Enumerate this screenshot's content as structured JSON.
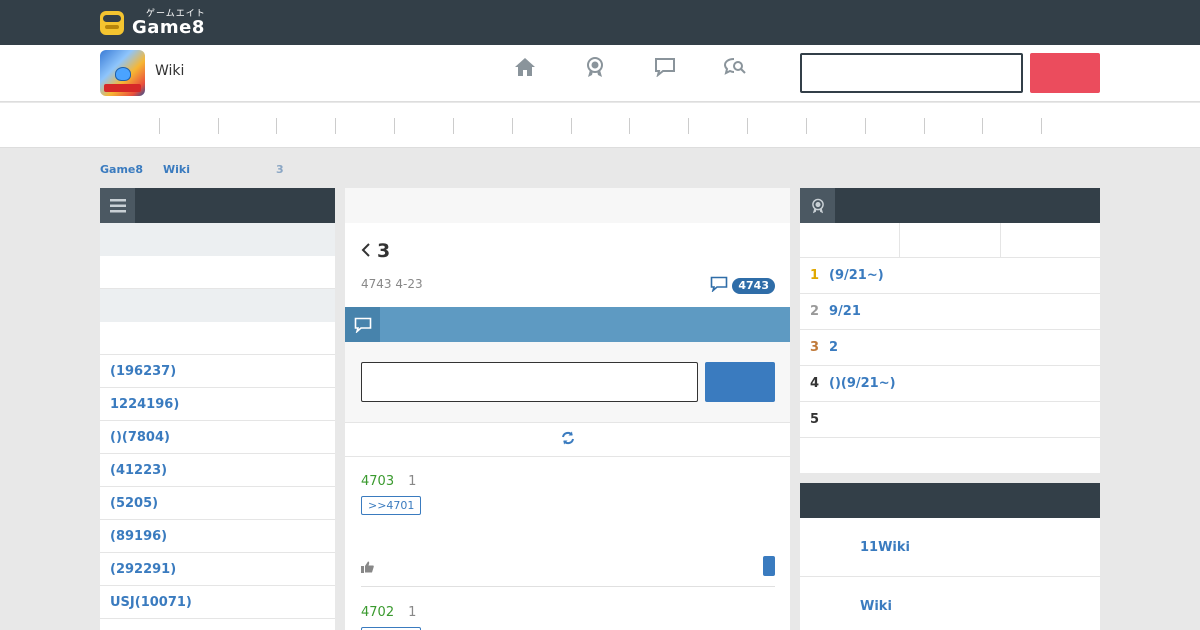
{
  "topbar": {
    "logo_kana": "ゲームエイト",
    "logo_word": "Game8"
  },
  "header": {
    "wiki_label": "Wiki",
    "search": {
      "value": "",
      "placeholder": ""
    },
    "search_button_label": ""
  },
  "breadcrumb": {
    "home": "Game8",
    "wiki": "Wiki",
    "current": "3"
  },
  "left": {
    "items": [
      {
        "label": "(196237)"
      },
      {
        "label": "1224196)"
      },
      {
        "label": "()(7804)"
      },
      {
        "label": "(41223)"
      },
      {
        "label": "(5205)"
      },
      {
        "label": "(89196)"
      },
      {
        "label": "(292291)"
      },
      {
        "label": "USJ(10071)"
      }
    ]
  },
  "thread": {
    "title": "3",
    "meta": "4743 4-23",
    "comment_count": "4743",
    "comment_input": {
      "value": "",
      "placeholder": ""
    },
    "post_button_label": "",
    "posts": [
      {
        "number": "4703",
        "sub": "1",
        "reply": ">>4701"
      },
      {
        "number": "4702",
        "sub": "1",
        "reply": ""
      }
    ]
  },
  "ranking": {
    "rows": [
      {
        "rank": "1",
        "text": "(9/21~)",
        "color": "#e0a800"
      },
      {
        "rank": "2",
        "text": "9/21",
        "color": "#999999"
      },
      {
        "rank": "3",
        "text": "2",
        "color": "#c07a3a"
      },
      {
        "rank": "4",
        "text": "()(9/21~)",
        "color": "#333333"
      },
      {
        "rank": "5",
        "text": "",
        "color": "#333333"
      }
    ]
  },
  "related": {
    "items": [
      {
        "label": "11Wiki"
      },
      {
        "label": "Wiki"
      }
    ]
  },
  "colors": {
    "topbar": "#333f48",
    "accent_blue": "#3a7bbf",
    "search_red": "#eb4c5d",
    "section_blue": "#5e9ac2",
    "green_number": "#3a9a2e"
  }
}
